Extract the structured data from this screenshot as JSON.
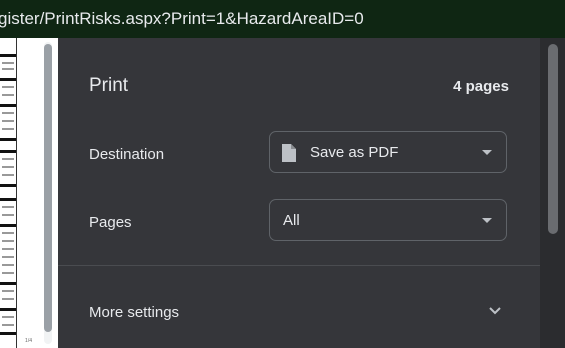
{
  "browser": {
    "url_text": "gister/PrintRisks.aspx?Print=1&HazardAreaID=0"
  },
  "preview": {
    "page_number": "1/4"
  },
  "print_panel": {
    "title": "Print",
    "page_count": "4 pages",
    "destination": {
      "label": "Destination",
      "value": "Save as PDF",
      "icon": "document-icon"
    },
    "pages": {
      "label": "Pages",
      "value": "All"
    },
    "more_settings": {
      "label": "More settings",
      "icon": "chevron-down-icon"
    }
  }
}
